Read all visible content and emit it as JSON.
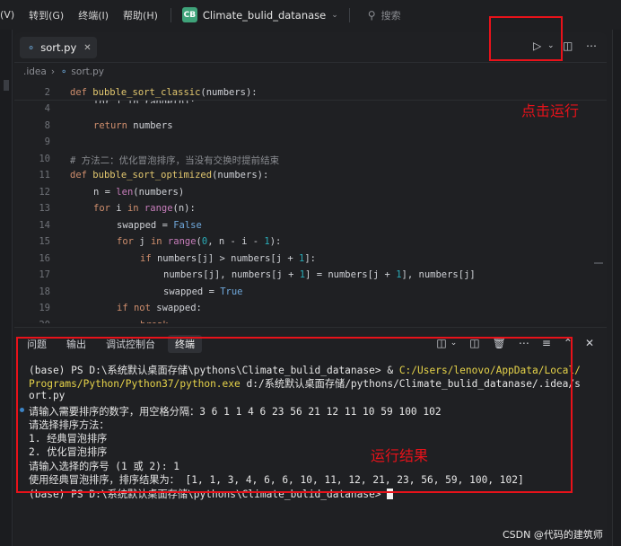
{
  "menubar": {
    "items": [
      "(V)",
      "转到(G)",
      "终端(I)",
      "帮助(H)"
    ],
    "project_badge": "CB",
    "project_name": "Climate_bulid_datanase",
    "search_placeholder": "搜索"
  },
  "editor": {
    "tab_name": "sort.py",
    "breadcrumb": [
      ".idea",
      "sort.py"
    ],
    "sticky_line": {
      "num": "2",
      "text": "def bubble_sort_classic(numbers):"
    },
    "ghost_line": "for i in range(n):",
    "lines": [
      {
        "num": "4",
        "html": "for i in range(n):"
      },
      {
        "num": "8",
        "text": "return numbers"
      },
      {
        "num": "9",
        "text": ""
      },
      {
        "num": "10",
        "text": "# 方法二：优化冒泡排序，当没有交换时提前结束"
      },
      {
        "num": "11",
        "text": "def bubble_sort_optimized(numbers):"
      },
      {
        "num": "12",
        "text": "n = len(numbers)"
      },
      {
        "num": "13",
        "text": "for i in range(n):"
      },
      {
        "num": "14",
        "text": "swapped = False"
      },
      {
        "num": "15",
        "text": "for j in range(0, n - i - 1):"
      },
      {
        "num": "16",
        "text": "if numbers[j] > numbers[j + 1]:"
      },
      {
        "num": "17",
        "text": "numbers[j], numbers[j + 1] = numbers[j + 1], numbers[j]"
      },
      {
        "num": "18",
        "text": "swapped = True"
      },
      {
        "num": "19",
        "text": "if not swapped:"
      },
      {
        "num": "20",
        "text": "break"
      }
    ],
    "annotation": "点击运行"
  },
  "terminal": {
    "tabs": [
      "问题",
      "输出",
      "调试控制台",
      "终端"
    ],
    "active_tab": "终端",
    "prompt_prefix": "(base) PS D:\\系统默认桌面存储\\pythons\\Climate_bulid_datanase> & ",
    "exe_path_1": "C:/Users/lenovo/AppData/Local/",
    "exe_path_2": "Programs/Python/Python37/python.exe",
    "script_arg_1": " d:/系统默认桌面存储/pythons/Climate_bulid_datanase/.idea/s",
    "script_arg_2": "ort.py",
    "output": [
      "请输入需要排序的数字，用空格分隔：3 6 1 1 4 6 23 56 21 12 11 10 59 100 102",
      "请选择排序方法：",
      "1. 经典冒泡排序",
      "2. 优化冒泡排序",
      "请输入选择的序号 (1 或 2): 1",
      "使用经典冒泡排序，排序结果为： [1, 1, 3, 4, 6, 6, 10, 11, 12, 21, 23, 56, 59, 100, 102]"
    ],
    "last_prompt": "(base) PS D:\\系统默认桌面存储\\pythons\\Climate_bulid_datanase> ",
    "annotation": "运行结果"
  },
  "watermark": "CSDN @代码的建筑师",
  "colors": {
    "annotation_red": "#e8121a",
    "path_yellow": "#e7d44a"
  }
}
